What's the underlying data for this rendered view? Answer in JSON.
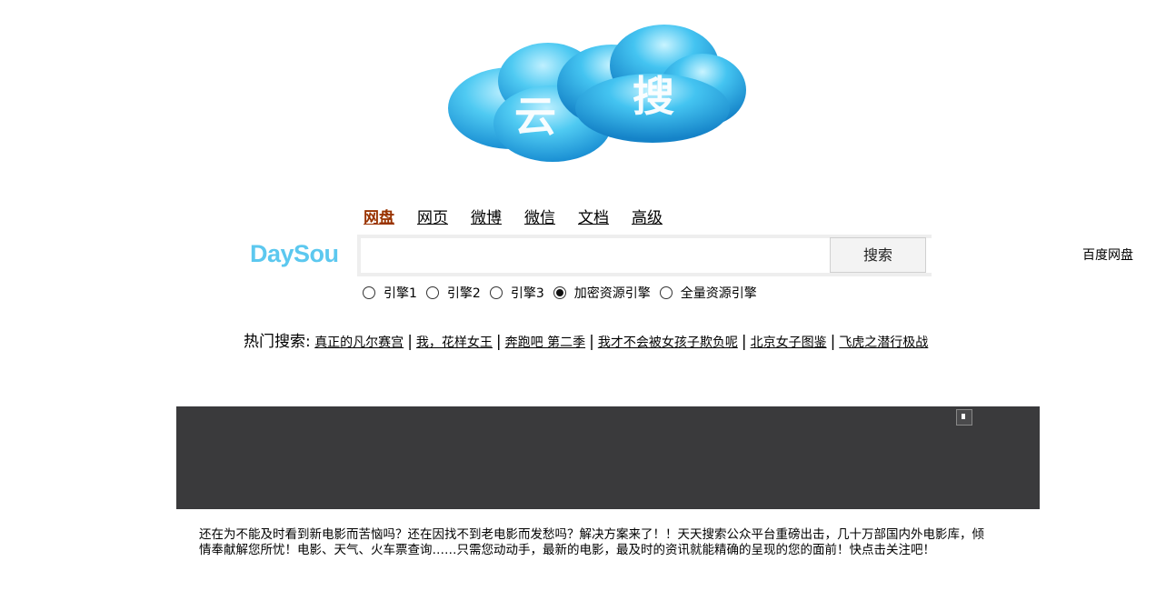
{
  "logo": {
    "char_left": "云",
    "char_right": "搜"
  },
  "brand": {
    "name": "DaySou"
  },
  "tabs": [
    {
      "label": "网盘",
      "active": true
    },
    {
      "label": "网页",
      "active": false
    },
    {
      "label": "微博",
      "active": false
    },
    {
      "label": "微信",
      "active": false
    },
    {
      "label": "文档",
      "active": false
    },
    {
      "label": "高级",
      "active": false
    }
  ],
  "search": {
    "value": "",
    "placeholder": "",
    "source_selected": "百度网盘",
    "button_label": "搜索"
  },
  "engines": [
    {
      "label": "引擎1",
      "checked": false
    },
    {
      "label": "引擎2",
      "checked": false
    },
    {
      "label": "引擎3",
      "checked": false
    },
    {
      "label": "加密资源引擎",
      "checked": true
    },
    {
      "label": "全量资源引擎",
      "checked": false
    }
  ],
  "hot": {
    "label": "热门搜索:",
    "items": [
      "真正的凡尔赛宫",
      "我，花样女王",
      "奔跑吧 第二季",
      "我才不会被女孩子欺负呢",
      "北京女子图鉴",
      "飞虎之潜行极战"
    ]
  },
  "description": "还在为不能及时看到新电影而苦恼吗？还在因找不到老电影而发愁吗？解决方案来了！！天天搜索公众平台重磅出击，几十万部国内外电影库，倾情奉献解您所忧！电影、天气、火车票查询……只需您动动手，最新的电影，最及时的资讯就能精确的呈现的您的面前！快点击关注吧！",
  "colors": {
    "brand": "#5cc8ef",
    "active_tab": "#993300",
    "banner": "#3a3a3c"
  }
}
